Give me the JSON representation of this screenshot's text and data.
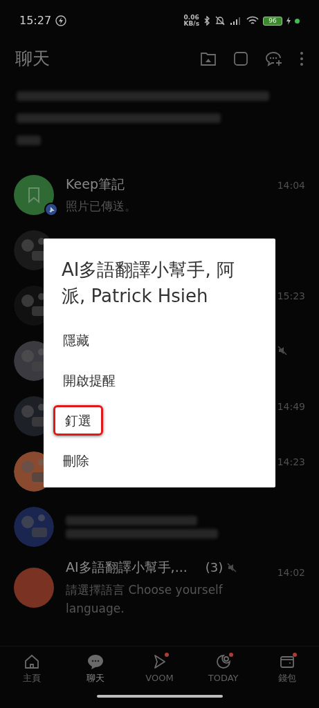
{
  "status_bar": {
    "time": "15:27",
    "speed_value": "0.06",
    "speed_unit": "KB/s",
    "battery": "96"
  },
  "header": {
    "title": "聊天"
  },
  "chats": [
    {
      "kind": "bookmark",
      "name": "Keep筆記",
      "preview": "照片已傳送。",
      "time": "14:04",
      "pinned": true,
      "muted": false
    },
    {
      "kind": "picture",
      "pinned": false,
      "muted": false
    },
    {
      "kind": "picture",
      "time": "15:23",
      "pinned": false,
      "muted": false
    },
    {
      "kind": "picture",
      "pinned": false,
      "muted": true
    },
    {
      "kind": "picture",
      "time": "14:49",
      "pinned": false,
      "muted": false
    },
    {
      "kind": "picture",
      "time": "14:23",
      "pinned": false,
      "muted": false
    },
    {
      "kind": "picture",
      "blurred": true,
      "pinned": false,
      "muted": false
    },
    {
      "kind": "plain",
      "name": "AI多語翻譯小幫手,...",
      "count": "(3)",
      "preview": "請選擇語言 Choose yourself language.",
      "time": "14:02",
      "pinned": false,
      "muted": true
    }
  ],
  "dialog": {
    "title": "AI多語翻譯小幫手, 阿派, Patrick Hsieh",
    "items": [
      {
        "label": "隱藏",
        "highlighted": false
      },
      {
        "label": "開啟提醒",
        "highlighted": false
      },
      {
        "label": "釘選",
        "highlighted": true
      },
      {
        "label": "刪除",
        "highlighted": false
      }
    ]
  },
  "nav": [
    {
      "kind": "home",
      "label": "主頁",
      "selected": false,
      "badge": false
    },
    {
      "kind": "chat",
      "label": "聊天",
      "selected": true,
      "badge": false
    },
    {
      "kind": "voom",
      "label": "VOOM",
      "selected": false,
      "badge": true
    },
    {
      "kind": "today",
      "label": "TODAY",
      "selected": false,
      "badge": true
    },
    {
      "kind": "wallet",
      "label": "錢包",
      "selected": false,
      "badge": true
    }
  ]
}
